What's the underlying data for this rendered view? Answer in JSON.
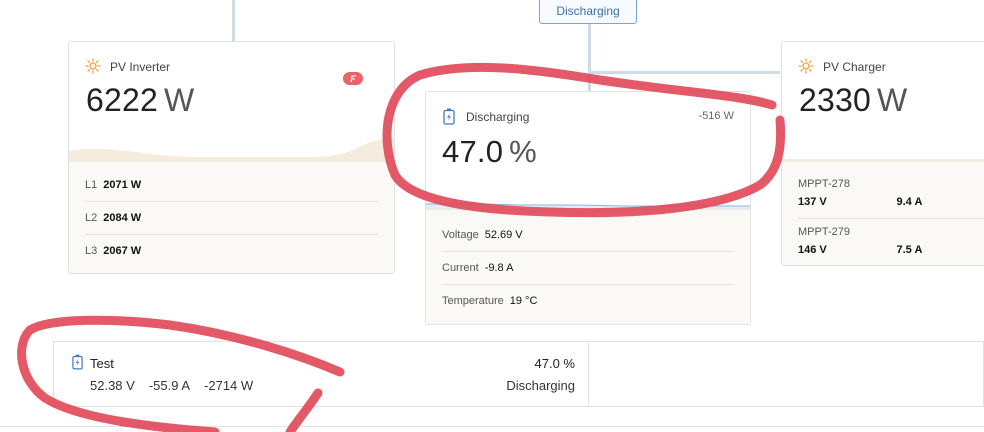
{
  "status_pill": {
    "label": "Discharging"
  },
  "pv_inverter": {
    "title": "PV Inverter",
    "value": "6222",
    "unit": "W",
    "badge": "F",
    "phases": [
      {
        "label": "L1",
        "value": "2071 W"
      },
      {
        "label": "L2",
        "value": "2084 W"
      },
      {
        "label": "L3",
        "value": "2067 W"
      }
    ]
  },
  "battery": {
    "title": "Discharging",
    "power": "-516 W",
    "value": "47.0",
    "unit": "%",
    "rows": [
      {
        "label": "Voltage",
        "value": "52.69 V"
      },
      {
        "label": "Current",
        "value": "-9.8 A"
      },
      {
        "label": "Temperature",
        "value": "19 °C"
      }
    ]
  },
  "pv_charger": {
    "title": "PV Charger",
    "value": "2330",
    "unit": "W",
    "mppts": [
      {
        "name": "MPPT-278",
        "voltage": "137 V",
        "current": "9.4 A"
      },
      {
        "name": "MPPT-279",
        "voltage": "146 V",
        "current": "7.5 A"
      }
    ]
  },
  "bottom_battery": {
    "title": "Test",
    "voltage": "52.38 V",
    "current": "-55.9 A",
    "power": "-2714 W",
    "soc": "47.0 %",
    "state": "Discharging"
  },
  "colors": {
    "accent_blue": "#3c6ea8",
    "sun_orange": "#f0a23a",
    "annotation_red": "#e14b5a"
  }
}
